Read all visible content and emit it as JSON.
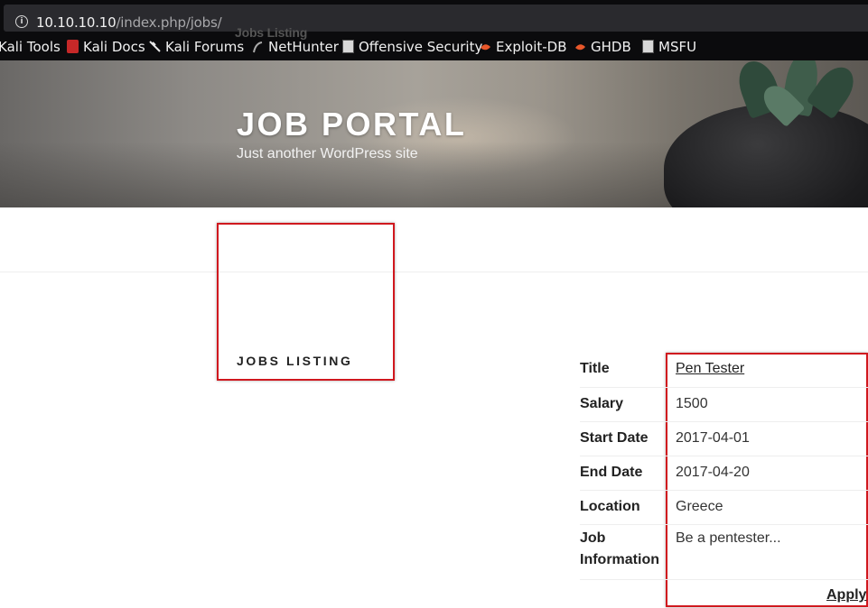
{
  "browser": {
    "url_host": "10.10.10.10",
    "url_path": "/index.php/jobs/",
    "bookmarks": [
      {
        "label": "Kali Tools",
        "icon": "none"
      },
      {
        "label": "Kali Docs",
        "icon": "kali-docs-icon"
      },
      {
        "label": "Kali Forums",
        "icon": "kali-dragon-icon"
      },
      {
        "label": "NetHunter",
        "icon": "nethunter-icon"
      },
      {
        "label": "Offensive Security",
        "icon": "offsec-icon"
      },
      {
        "label": "Exploit-DB",
        "icon": "exploitdb-icon"
      },
      {
        "label": "GHDB",
        "icon": "ghdb-icon"
      },
      {
        "label": "MSFU",
        "icon": "msfu-icon"
      }
    ]
  },
  "site": {
    "title": "JOB PORTAL",
    "description": "Just another WordPress site"
  },
  "nav": {
    "item": "Jobs Listing"
  },
  "page": {
    "heading": "JOBS LISTING"
  },
  "job": {
    "rows": [
      {
        "key": "Title",
        "value": "Pen Tester"
      },
      {
        "key": "Salary",
        "value": "1500"
      },
      {
        "key": "Start Date",
        "value": "2017-04-01"
      },
      {
        "key": "End Date",
        "value": "2017-04-20"
      },
      {
        "key": "Location",
        "value": "Greece"
      },
      {
        "key": "Job Information",
        "value": "Be a pentester..."
      }
    ],
    "apply_label": "Apply"
  },
  "colors": {
    "highlight_box": "#d0181e",
    "chrome_bg": "#0b0b0d"
  }
}
